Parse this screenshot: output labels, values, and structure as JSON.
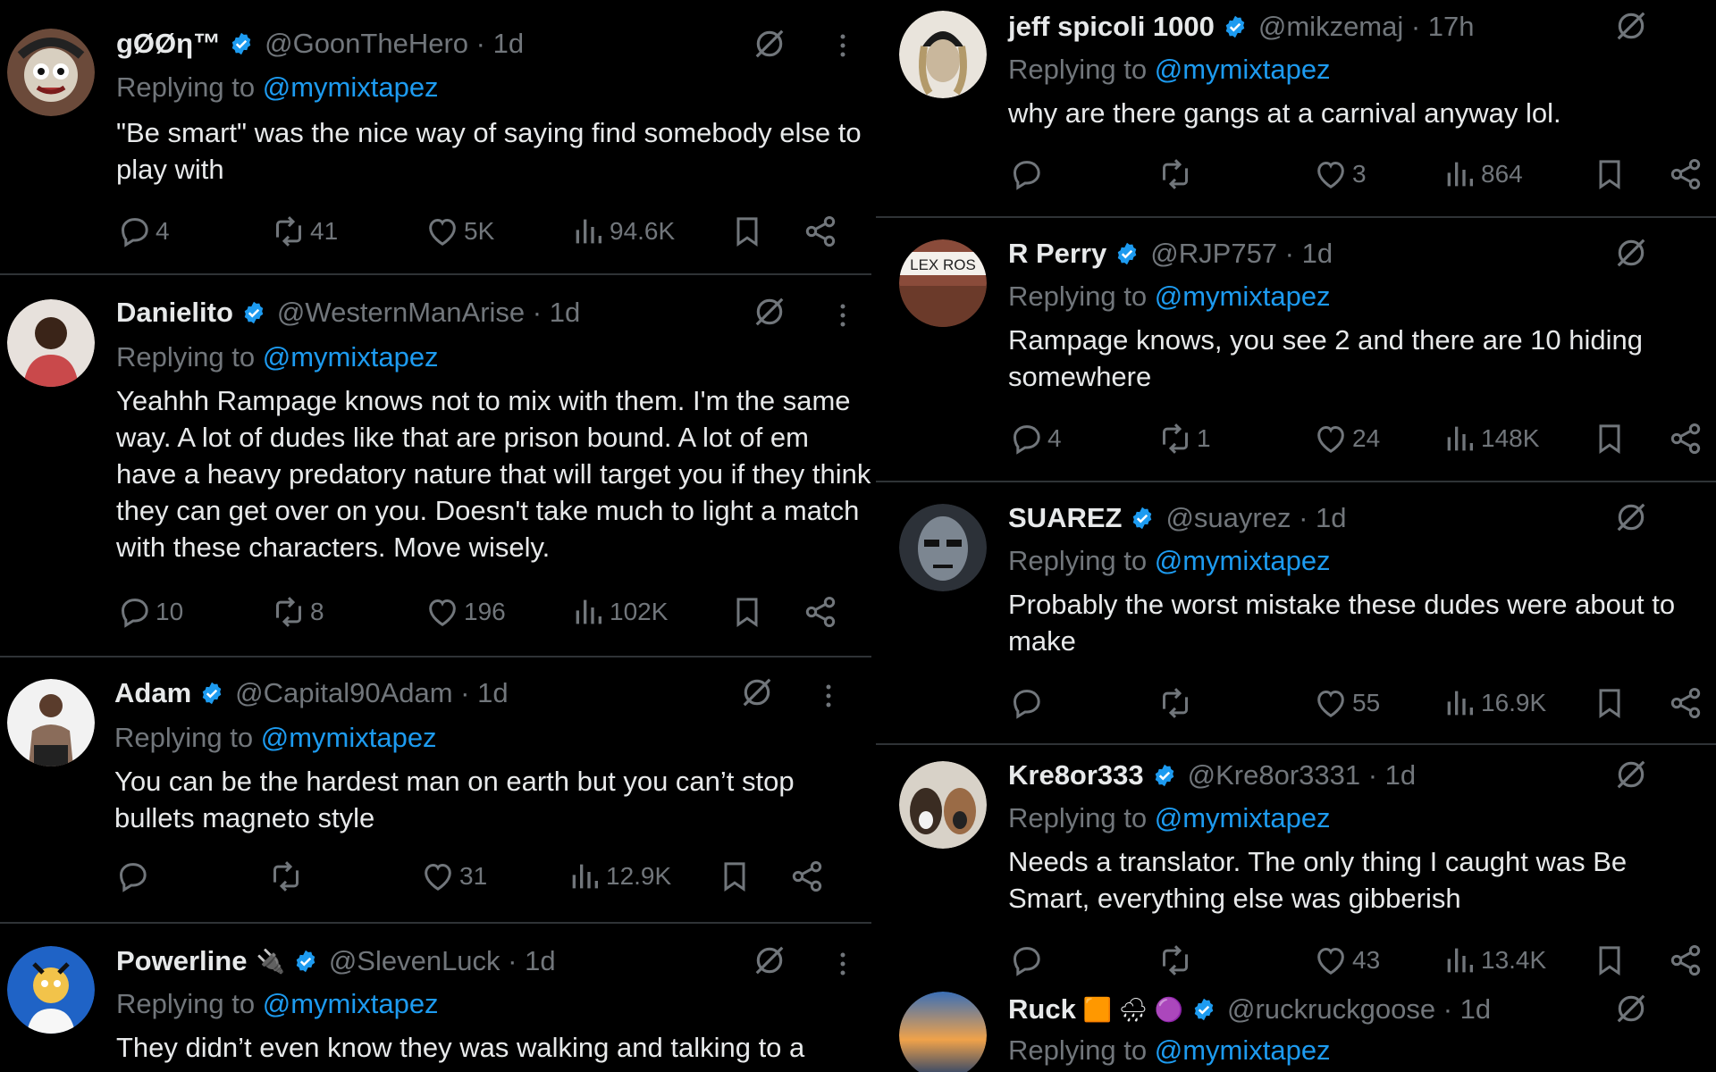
{
  "left_tweets": [
    {
      "name": "gØØη™",
      "handle": "@GoonTheHero · 1d",
      "replying_label": "Replying to",
      "replying_to": "@mymixtapez",
      "text": "\"Be smart\" was the nice way of saying find somebody else to play with",
      "replies": "4",
      "reposts": "41",
      "likes": "5K",
      "views": "94.6K",
      "avatar_color": "#6b4a3a"
    },
    {
      "name": "Danielito",
      "handle": "@WesternManArise · 1d",
      "replying_label": "Replying to",
      "replying_to": "@mymixtapez",
      "text": "Yeahhh Rampage knows not to mix with them. I'm the same way. A lot of dudes like that are prison bound. A lot of em have a heavy predatory nature that will target you if they think they can get over on you. Doesn't take much to light a match with these characters. Move wisely.",
      "replies": "10",
      "reposts": "8",
      "likes": "196",
      "views": "102K",
      "avatar_color": "#c9494b"
    },
    {
      "name": "Adam",
      "handle": "@Capital90Adam · 1d",
      "replying_label": "Replying to",
      "replying_to": "@mymixtapez",
      "text": "You can be the hardest man on earth but you can’t stop bullets magneto style",
      "replies": "",
      "reposts": "",
      "likes": "31",
      "views": "12.9K",
      "avatar_color": "#8a6c5a"
    },
    {
      "name": "Powerline",
      "handle": "@SlevenLuck · 1d",
      "replying_label": "Replying to",
      "replying_to": "@mymixtapez",
      "text": "They didn’t even know they was walking and talking to a",
      "replies": "",
      "reposts": "",
      "likes": "",
      "views": "",
      "avatar_color": "#1f63c6"
    }
  ],
  "right_tweets": [
    {
      "name": "jeff spicoli 1000",
      "handle": "@mikzemaj · 17h",
      "replying_label": "Replying to",
      "replying_to": "@mymixtapez",
      "text": "why are there gangs at a carnival anyway lol.",
      "replies": "",
      "reposts": "",
      "likes": "3",
      "views": "864",
      "avatar_color": "#c9b79c"
    },
    {
      "name": "R Perry",
      "handle": "@RJP757 · 1d",
      "replying_label": "Replying to",
      "replying_to": "@mymixtapez",
      "text": "Rampage knows, you see 2 and there  are 10 hiding somewhere",
      "replies": "4",
      "reposts": "1",
      "likes": "24",
      "views": "148K",
      "avatar_color": "#8a4b3a",
      "avatar_text": "LEX ROS"
    },
    {
      "name": "SUAREZ",
      "handle": "@suayrez · 1d",
      "replying_label": "Replying to",
      "replying_to": "@mymixtapez",
      "text": "Probably the worst mistake these dudes were about to make",
      "replies": "",
      "reposts": "",
      "likes": "55",
      "views": "16.9K",
      "avatar_color": "#5b6470"
    },
    {
      "name": "Kre8or333",
      "handle": "@Kre8or3331 · 1d",
      "replying_label": "Replying to",
      "replying_to": "@mymixtapez",
      "text": "Needs a translator. The only thing I caught was Be Smart, everything else was gibberish",
      "replies": "",
      "reposts": "",
      "likes": "43",
      "views": "13.4K",
      "avatar_color": "#9a6b46"
    },
    {
      "name": "Ruck",
      "name_emojis": "🟧 🌧 🟣",
      "handle": "@ruckruckgoose · 1d",
      "replying_label": "Replying to",
      "replying_to": "@mymixtapez",
      "text": "",
      "replies": "",
      "reposts": "",
      "likes": "",
      "views": "",
      "avatar_color": "#d98a3a"
    }
  ],
  "extras": {
    "powerline_badge": "🔌"
  },
  "colors": {
    "background": "#000000",
    "text": "#e7e9ea",
    "muted": "#71767b",
    "accent": "#1d9bf0",
    "divider": "#2f3336"
  },
  "icons": [
    "reply-icon",
    "repost-icon",
    "like-icon",
    "views-icon",
    "bookmark-icon",
    "share-icon",
    "grok-icon",
    "more-icon",
    "verified-icon"
  ]
}
